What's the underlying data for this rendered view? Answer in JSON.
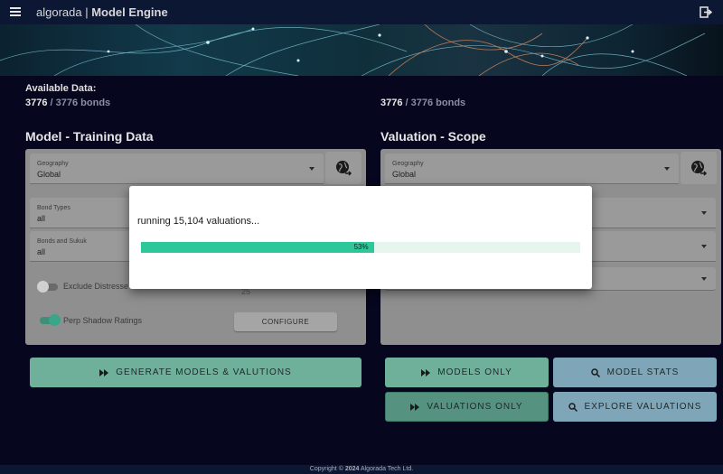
{
  "appbar": {
    "brand": "algorada",
    "separator": " | ",
    "title": "Model Engine",
    "menu_icon": "menu-icon",
    "logout_icon": "logout-icon"
  },
  "available": {
    "label": "Available Data:",
    "left": {
      "count": "3776",
      "total": " / 3776 bonds"
    },
    "right": {
      "count": "3776",
      "total": " / 3776 bonds"
    }
  },
  "training": {
    "title": "Model - Training Data",
    "geography": {
      "label": "Geography",
      "value": "Global"
    },
    "bond_types": {
      "label": "Bond Types",
      "value": "all"
    },
    "bonds_sukuk": {
      "label": "Bonds and Sukuk",
      "value": "all"
    },
    "exclude_label": "Exclude Distresse",
    "exclude_value": "25",
    "exclude_on": false,
    "perp_label": "Perp Shadow Ratings",
    "perp_on": true,
    "configure_label": "CONFIGURE"
  },
  "valuation": {
    "title": "Valuation - Scope",
    "geography": {
      "label": "Geography",
      "value": "Global"
    }
  },
  "buttons": {
    "generate": "GENERATE MODELS & VALUTIONS",
    "models_only": "MODELS ONLY",
    "model_stats": "MODEL STATS",
    "valuations_only": "VALUATIONS ONLY",
    "explore_valuations": "EXPLORE VALUATIONS"
  },
  "colors": {
    "primary_button": "#6fb09b",
    "secondary_button": "#7fa6b8",
    "progress_fill": "#2ec79a",
    "progress_track": "#e6f6ef"
  },
  "dialog": {
    "message": "running 15,104 valuations...",
    "progress": 0.53,
    "progress_label": "53%"
  },
  "footer": {
    "prefix": "Copyright © ",
    "year": "2024",
    "suffix": " Algorada Tech Ltd."
  }
}
